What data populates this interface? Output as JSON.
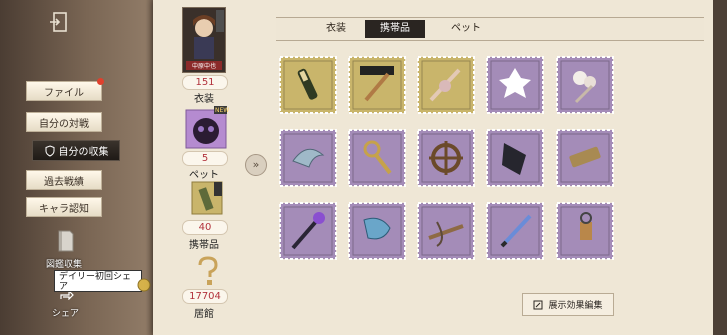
{
  "sidebar": {
    "items": [
      {
        "label": "ファイル"
      },
      {
        "label": "自分の対戦"
      },
      {
        "label": "自分の収集"
      },
      {
        "label": "過去戦績"
      },
      {
        "label": "キャラ認知"
      }
    ],
    "encyclopedia_label": "図鑑収集",
    "share_label": "シェア",
    "tooltip_text": "デイリー初回シェア"
  },
  "profile": {
    "name": "中原中也",
    "new_badge": "NEW",
    "stats": [
      {
        "value": "151",
        "label": "衣装"
      },
      {
        "value": "5",
        "label": "ペット"
      },
      {
        "value": "40",
        "label": "携帯品"
      },
      {
        "value": "17704",
        "label": "居館"
      }
    ]
  },
  "tabs": [
    {
      "label": "衣装",
      "active": false
    },
    {
      "label": "携帯品",
      "active": true
    },
    {
      "label": "ペット",
      "active": false
    }
  ],
  "items": [
    {
      "icon": "champagne-bottle-icon",
      "frame": "gold"
    },
    {
      "icon": "bungo-stray-dogs-wand-icon",
      "frame": "gold"
    },
    {
      "icon": "ribbon-wand-icon",
      "frame": "gold"
    },
    {
      "icon": "white-flower-wand-icon",
      "frame": "purple"
    },
    {
      "icon": "pearl-cluster-wand-icon",
      "frame": "purple"
    },
    {
      "icon": "mermaid-tail-icon",
      "frame": "purple"
    },
    {
      "icon": "golden-scepter-icon",
      "frame": "purple"
    },
    {
      "icon": "ship-wheel-icon",
      "frame": "purple"
    },
    {
      "icon": "black-ribbon-sash-icon",
      "frame": "purple"
    },
    {
      "icon": "feather-quill-case-icon",
      "frame": "purple"
    },
    {
      "icon": "crystal-staff-icon",
      "frame": "purple"
    },
    {
      "icon": "ornate-axe-icon",
      "frame": "purple"
    },
    {
      "icon": "crossbow-icon",
      "frame": "purple"
    },
    {
      "icon": "blue-sword-icon",
      "frame": "purple"
    },
    {
      "icon": "lantern-key-icon",
      "frame": "purple"
    }
  ],
  "edit_button_label": "展示効果編集",
  "colors": {
    "gold_frame": "#c9b56b",
    "purple_frame": "#a48cb8",
    "panel": "#efe7d6",
    "active_tab": "#2a2521",
    "stat_value": "#b2323c"
  }
}
